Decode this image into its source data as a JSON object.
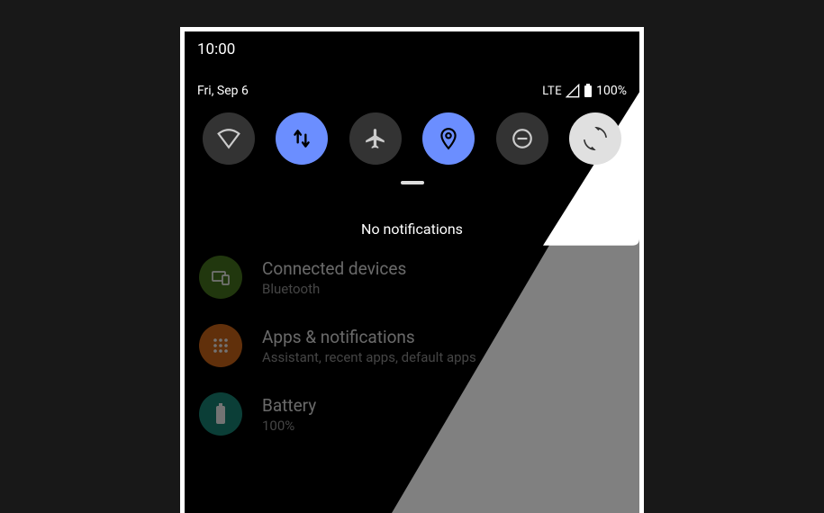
{
  "status": {
    "time": "10:00",
    "date": "Fri, Sep 6",
    "network_type": "LTE",
    "battery_pct": "100%"
  },
  "quick_settings": {
    "tiles": [
      {
        "name": "wifi",
        "on": false
      },
      {
        "name": "mobile-data",
        "on": true
      },
      {
        "name": "airplane-mode",
        "on": false
      },
      {
        "name": "location",
        "on": true
      },
      {
        "name": "do-not-disturb",
        "on": false
      },
      {
        "name": "auto-rotate",
        "on": false
      }
    ]
  },
  "notifications": {
    "empty_text": "No notifications"
  },
  "settings": {
    "items": [
      {
        "title": "Connected devices",
        "subtitle": "Bluetooth",
        "icon": "devices",
        "color": "green"
      },
      {
        "title": "Apps & notifications",
        "subtitle": "Assistant, recent apps, default apps",
        "icon": "apps",
        "color": "orange"
      },
      {
        "title": "Battery",
        "subtitle": "100%",
        "icon": "battery",
        "color": "teal"
      }
    ]
  }
}
